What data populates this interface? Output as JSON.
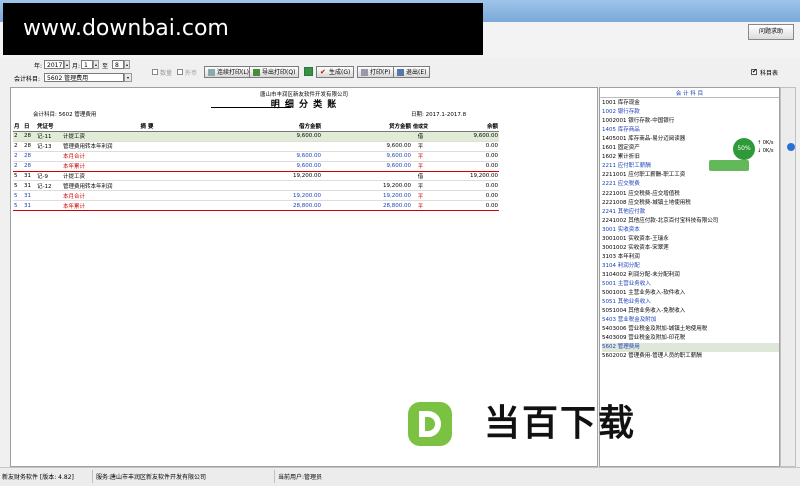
{
  "watermark": {
    "text": "www.downbai.com"
  },
  "help_button": {
    "label": "问题求助"
  },
  "toolbar": {
    "year_label": "年:",
    "year_value": "2017",
    "month_label": "月:",
    "month_from": "1",
    "to_label": "至",
    "month_to": "8",
    "account_label": "会计科目:",
    "account_value": "5602 管理费用",
    "qty_label": "数量",
    "foreign_label": "外币",
    "continuous_print_label": "连续打印(L)",
    "export_print_label": "导出打印(Q)",
    "generate_label": "生成(G)",
    "print_label": "打印(P)",
    "exit_label": "退出(E)",
    "subject_table_label": "科目表"
  },
  "report": {
    "company": "唐山市丰润区新友软件开发有限公司",
    "title": "明 细 分 类 账",
    "account_line": "会计科目:  5602 管理费用",
    "date_range": "日期: 2017.1-2017.8",
    "headers": {
      "month": "月",
      "day": "日",
      "voucher": "凭证号",
      "summary": "摘 要",
      "debit": "借方金额",
      "credit": "贷方金额",
      "direction": "借或贷",
      "balance": "余额"
    },
    "rows": [
      {
        "m": "2",
        "d": "28",
        "v": "记-11",
        "s": "计提工资",
        "dr": "9,600.00",
        "cr": "",
        "dir": "借",
        "bal": "9,600.00",
        "kind": "hl"
      },
      {
        "m": "2",
        "d": "28",
        "v": "记-13",
        "s": "管理费用转本年利润",
        "dr": "",
        "cr": "9,600.00",
        "dir": "平",
        "bal": "0.00",
        "kind": "normal"
      },
      {
        "m": "2",
        "d": "28",
        "v": "",
        "s": "本月合计",
        "dr": "9,600.00",
        "cr": "9,600.00",
        "dir": "平",
        "bal": "0.00",
        "kind": "sum"
      },
      {
        "m": "2",
        "d": "28",
        "v": "",
        "s": "本年累计",
        "dr": "9,600.00",
        "cr": "9,600.00",
        "dir": "平",
        "bal": "0.00",
        "kind": "sumline"
      },
      {
        "m": "5",
        "d": "31",
        "v": "记-9",
        "s": "计提工资",
        "dr": "19,200.00",
        "cr": "",
        "dir": "借",
        "bal": "19,200.00",
        "kind": "normal"
      },
      {
        "m": "5",
        "d": "31",
        "v": "记-12",
        "s": "管理费用转本年利润",
        "dr": "",
        "cr": "19,200.00",
        "dir": "平",
        "bal": "0.00",
        "kind": "normal"
      },
      {
        "m": "5",
        "d": "31",
        "v": "",
        "s": "本月合计",
        "dr": "19,200.00",
        "cr": "19,200.00",
        "dir": "平",
        "bal": "0.00",
        "kind": "sum"
      },
      {
        "m": "5",
        "d": "31",
        "v": "",
        "s": "本年累计",
        "dr": "28,800.00",
        "cr": "28,800.00",
        "dir": "平",
        "bal": "0.00",
        "kind": "sumline"
      }
    ]
  },
  "side_panel": {
    "header": "会 计 科 目",
    "items": [
      {
        "text": "1001 库存现金",
        "kind": "normal"
      },
      {
        "text": "1002 银行存款",
        "kind": "blue"
      },
      {
        "text": "1002001 银行存款-中国银行",
        "kind": "normal"
      },
      {
        "text": "1405 库存商品",
        "kind": "blue"
      },
      {
        "text": "1405001 库存商品-易分迈阅读器",
        "kind": "normal"
      },
      {
        "text": "1601 固定资产",
        "kind": "normal"
      },
      {
        "text": "1602 累计折旧",
        "kind": "normal"
      },
      {
        "text": "2211 应付职工薪酬",
        "kind": "blue"
      },
      {
        "text": "2211001 应付职工薪酬-职工工资",
        "kind": "normal"
      },
      {
        "text": "2221 应交税费",
        "kind": "blue"
      },
      {
        "text": "2221001 应交税费-应交增值税",
        "kind": "normal"
      },
      {
        "text": "2221008 应交税费-城镇土地使用税",
        "kind": "normal"
      },
      {
        "text": "2241 其他应付款",
        "kind": "blue"
      },
      {
        "text": "2241002 其他应付款-北京百付宝科技有限公司",
        "kind": "normal"
      },
      {
        "text": "3001 实收资本",
        "kind": "blue"
      },
      {
        "text": "3001001 实收资本-王瑞永",
        "kind": "normal"
      },
      {
        "text": "3001002 实收资本-宋翠莲",
        "kind": "normal"
      },
      {
        "text": "3103 本年利润",
        "kind": "normal"
      },
      {
        "text": "3104 利润分配",
        "kind": "blue"
      },
      {
        "text": "3104002 利润分配-未分配利润",
        "kind": "normal"
      },
      {
        "text": "5001 主营业务收入",
        "kind": "blue"
      },
      {
        "text": "5001001 主营业务收入-软件收入",
        "kind": "normal"
      },
      {
        "text": "5051 其他业务收入",
        "kind": "blue"
      },
      {
        "text": "5051004 其他业务收入-免税收入",
        "kind": "normal"
      },
      {
        "text": "5403 营业税金及附加",
        "kind": "blue"
      },
      {
        "text": "5403006 营业税金及附加-城镇土地使用税",
        "kind": "normal"
      },
      {
        "text": "5403009 营业税金及附加-印花税",
        "kind": "normal"
      },
      {
        "text": "5602 管理费用",
        "kind": "sel"
      },
      {
        "text": "5602002 管理费用-管理人员的职工薪酬",
        "kind": "normal"
      }
    ]
  },
  "float_widget": {
    "percent": "50%",
    "up": "0K/s",
    "down": "0K/s"
  },
  "status_bar": {
    "app": "新友财务软件 [版本: 4.82]",
    "owner": "服务:唐山市丰润区新友软件开发有限公司",
    "user": "当前用户:管理员"
  },
  "brand_watermark": {
    "text": "当百下载"
  },
  "colors": {
    "accent_blue": "#1a3fb8",
    "sum_red": "#d00000",
    "highlight": "#e1ecd6"
  }
}
